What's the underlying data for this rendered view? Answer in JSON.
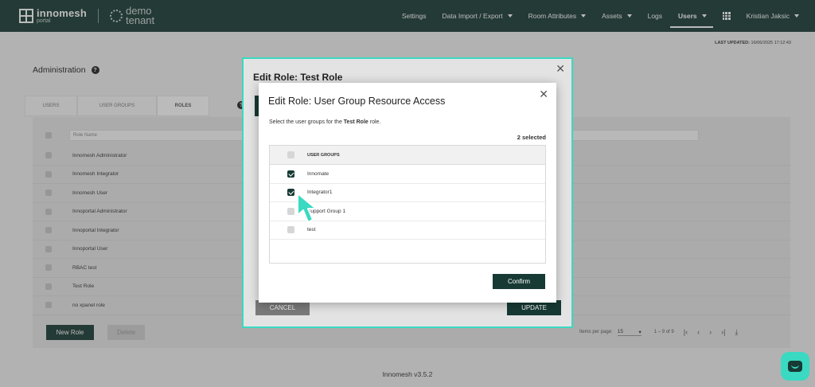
{
  "nav": {
    "logo_line1": "innomesh",
    "logo_line2": "portal",
    "tenant": "demo tenant",
    "items": [
      {
        "label": "Settings",
        "caret": false
      },
      {
        "label": "Data Import / Export",
        "caret": true
      },
      {
        "label": "Room Attributes",
        "caret": true
      },
      {
        "label": "Assets",
        "caret": true
      },
      {
        "label": "Logs",
        "caret": false
      },
      {
        "label": "Users",
        "caret": true,
        "active": true
      }
    ],
    "user": "Kristian Jaksic"
  },
  "last_updated": {
    "label": "LAST UPDATED:",
    "value": "16/06/2025 17:12:43"
  },
  "page_title": "Administration",
  "tabs": [
    "USERS",
    "USER GROUPS",
    "ROLES"
  ],
  "active_tab": "ROLES",
  "roles_table": {
    "column_header": "Role Name",
    "rows": [
      "Innomesh Administrator",
      "Innomesh Integrator",
      "Innomesh User",
      "Innoportal Administrator",
      "Innoportal Integrator",
      "Innoportal User",
      "RBAC test",
      "Test Role",
      "no xpanel role"
    ]
  },
  "buttons": {
    "new_role": "New Role",
    "delete": "Delete"
  },
  "paginator": {
    "items_per_page_label": "Items per page:",
    "page_size": "15",
    "range": "1 – 9 of 9"
  },
  "footer_version": "Innomesh v3.5.2",
  "outer_dialog": {
    "title": "Edit Role: Test Role",
    "cancel": "CANCEL",
    "update": "UPDATE"
  },
  "inner_dialog": {
    "title": "Edit Role: User Group Resource Access",
    "desc_prefix": "Select the user groups for the",
    "role_name": "Test Role",
    "desc_suffix": "role.",
    "selected_count": "2 selected",
    "table_header": "USER GROUPS",
    "groups": [
      {
        "label": "Innomate",
        "checked": true
      },
      {
        "label": "Integrator1",
        "checked": true
      },
      {
        "label": "Support Group 1",
        "checked": false
      },
      {
        "label": "test",
        "checked": false
      }
    ],
    "confirm": "Confirm"
  },
  "colors": {
    "brand": "#173a34",
    "accent": "#3ad9c1"
  }
}
